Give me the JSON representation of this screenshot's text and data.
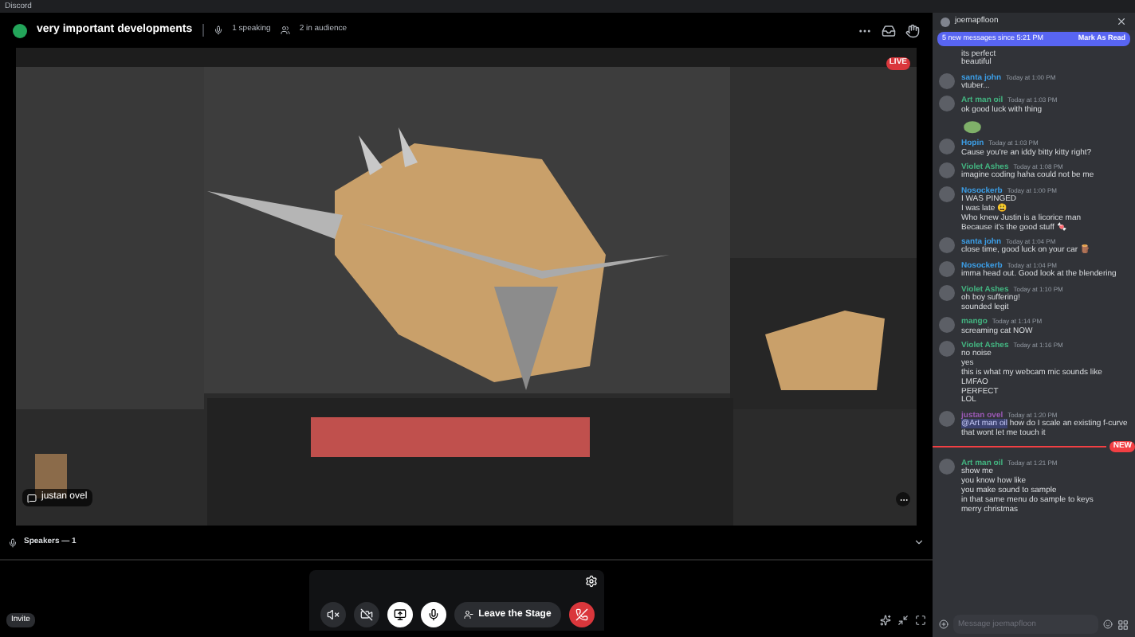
{
  "window": {
    "title": "Discord"
  },
  "stage": {
    "title": "very important developments",
    "speaking": "1 speaking",
    "audience": "2 in audience"
  },
  "stream": {
    "kind": "picture",
    "streamer": "justan ovel",
    "badge": "LIVE"
  },
  "speakers": {
    "label": "Speakers — 1"
  },
  "controls": [
    {
      "kind": "round",
      "on": false
    },
    {
      "kind": "round",
      "on": false
    },
    {
      "kind": "round",
      "on": true
    },
    {
      "kind": "round",
      "on": true
    },
    {
      "kind": "pill",
      "label": "Leave the Stage"
    },
    {
      "kind": "hangup"
    }
  ],
  "invite": "Invite",
  "chat": {
    "title": "joemapfloon",
    "banner": "5 new messages since 5:21 PM",
    "mark_read": "Mark As Read",
    "placeholder": "Message joemapfloon",
    "messages": [
      {
        "lines": [
          "its perfect",
          "beautiful"
        ]
      },
      {
        "author": "santa john",
        "color": "#3c9ee6",
        "time": "Today at 1:00 PM",
        "lines": [
          "vtuber..."
        ]
      },
      {
        "author": "Art man oil",
        "color": "#43b581",
        "time": "Today at 1:03 PM",
        "lines": [
          "ok good luck with thing"
        ],
        "attachment": {
          "kind": "sticker"
        }
      },
      {
        "author": "Hopin",
        "color": "#3c9ee6",
        "time": "Today at 1:03 PM",
        "lines": [
          "Cause you're an iddy bitty kitty right?"
        ]
      },
      {
        "author": "Violet Ashes",
        "color": "#43b581",
        "time": "Today at 1:08 PM",
        "lines": [
          "imagine coding haha could not be me"
        ]
      },
      {
        "author": "Nosockerb",
        "color": "#3c9ee6",
        "time": "Today at 1:00 PM",
        "lines": [
          "I WAS PINGED",
          "I was late 😩",
          "Who knew Justin is a licorice man",
          "Because it's the good stuff 🍬"
        ]
      },
      {
        "author": "santa john",
        "color": "#3c9ee6",
        "time": "Today at 1:04 PM",
        "lines": [
          "close time, good luck on your car 🪵"
        ]
      },
      {
        "author": "Nosockerb",
        "color": "#3c9ee6",
        "time": "Today at 1:04 PM",
        "lines": [
          "imma head out. Good look at the blendering"
        ]
      },
      {
        "author": "Violet Ashes",
        "color": "#43b581",
        "time": "Today at 1:10 PM",
        "lines": [
          "oh boy suffering!",
          "sounded legit"
        ]
      },
      {
        "author": "mango",
        "color": "#43b581",
        "time": "Today at 1:14 PM",
        "lines": [
          "screaming cat NOW"
        ]
      },
      {
        "author": "Violet Ashes",
        "color": "#43b581",
        "time": "Today at 1:16 PM",
        "lines": [
          "no noise",
          "yes",
          "this is what my webcam mic sounds like",
          "LMFAO",
          "PERFECT",
          "LOL"
        ]
      },
      {
        "author": "justan ovel",
        "color": "#9b59b6",
        "time": "Today at 1:20 PM",
        "mention": "@Art man oil",
        "lines": [
          "how do I scale an existing f-curve that wont let me touch it"
        ]
      },
      {
        "divider": "NEW",
        "author": "Art man oil",
        "color": "#43b581",
        "time": "Today at 1:21 PM",
        "lines": [
          "show me",
          "you know how like",
          "you make sound to sample",
          "in that same menu do sample to keys",
          "merry christmas"
        ]
      }
    ]
  }
}
